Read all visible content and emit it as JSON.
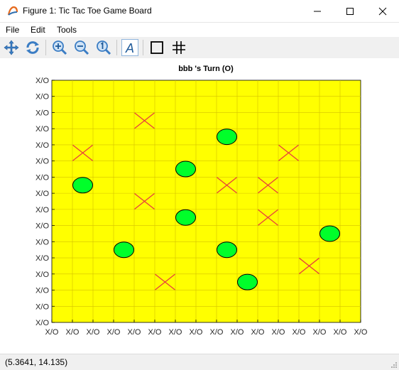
{
  "window": {
    "title": "Figure 1: Tic Tac Toe Game Board"
  },
  "menu": {
    "items": [
      "File",
      "Edit",
      "Tools"
    ]
  },
  "toolbar": {
    "buttons": [
      "pan-icon",
      "rotate-icon",
      "zoom-in-icon",
      "zoom-out-icon",
      "zoom-reset-icon",
      "text-annotation-icon",
      "box-icon",
      "grid-icon"
    ]
  },
  "status": {
    "coords": "(5.3641, 14.135)"
  },
  "colors": {
    "board_background": "#ffff00",
    "o_fill": "#00ff2a",
    "x_stroke": "#e8403c",
    "grid_line": "#d4c200"
  },
  "chart_data": {
    "type": "scatter",
    "title": "bbb 's Turn (O)",
    "xlabel": "",
    "ylabel": "",
    "xlim": [
      0,
      15
    ],
    "ylim": [
      0,
      15
    ],
    "grid": true,
    "x_ticks": [
      0,
      1,
      2,
      3,
      4,
      5,
      6,
      7,
      8,
      9,
      10,
      11,
      12,
      13,
      14,
      15
    ],
    "y_ticks": [
      0,
      1,
      2,
      3,
      4,
      5,
      6,
      7,
      8,
      9,
      10,
      11,
      12,
      13,
      14,
      15
    ],
    "tick_label": "X/O",
    "series": [
      {
        "marker": "O",
        "points": [
          [
            1.5,
            8.5
          ],
          [
            6.5,
            9.5
          ],
          [
            8.5,
            11.5
          ],
          [
            6.5,
            6.5
          ],
          [
            13.5,
            5.5
          ],
          [
            3.5,
            4.5
          ],
          [
            8.5,
            4.5
          ],
          [
            9.5,
            2.5
          ]
        ]
      },
      {
        "marker": "X",
        "points": [
          [
            4.5,
            12.5
          ],
          [
            1.5,
            10.5
          ],
          [
            11.5,
            10.5
          ],
          [
            8.5,
            8.5
          ],
          [
            10.5,
            8.5
          ],
          [
            4.5,
            7.5
          ],
          [
            10.5,
            6.5
          ],
          [
            12.5,
            3.5
          ],
          [
            5.5,
            2.5
          ]
        ]
      }
    ]
  }
}
